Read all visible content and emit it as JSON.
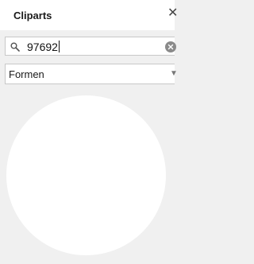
{
  "panel": {
    "title": "Cliparts",
    "close_glyph": "✕"
  },
  "search": {
    "value": "97692",
    "icon": "search-icon",
    "clear_icon": "clear-icon"
  },
  "category": {
    "selected": "Formen",
    "icon": "chevron-down-icon"
  },
  "results": {
    "items": [
      "circle-shape"
    ]
  },
  "colors": {
    "background": "#f0f0f0",
    "surface": "#ffffff",
    "border": "#c8c8c8"
  }
}
